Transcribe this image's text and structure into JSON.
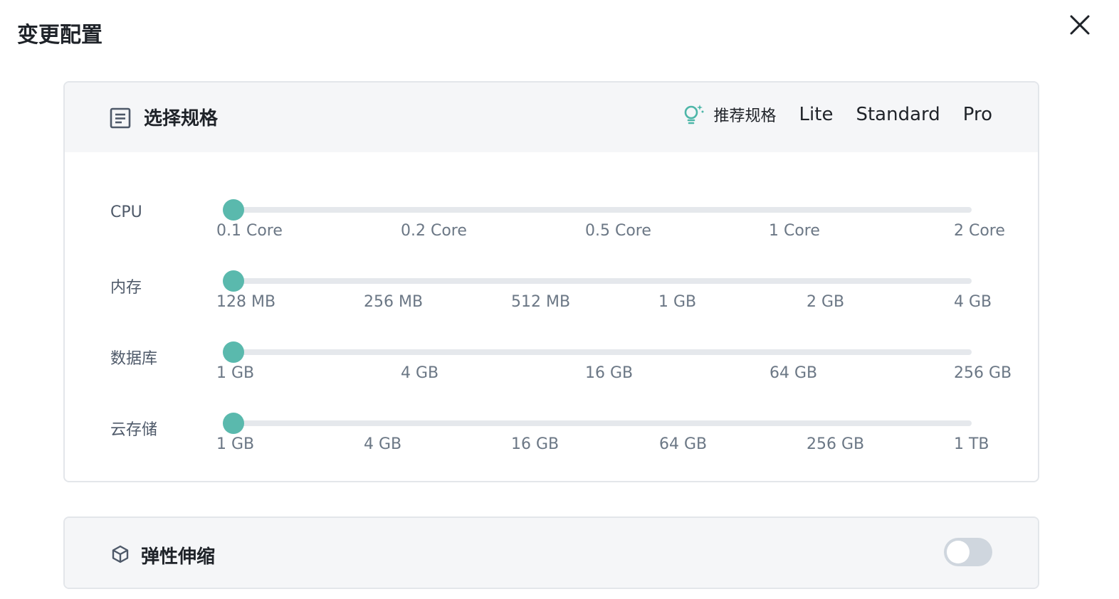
{
  "modal": {
    "title": "变更配置"
  },
  "spec": {
    "title": "选择规格",
    "recommend_label": "推荐规格",
    "presets": [
      "Lite",
      "Standard",
      "Pro"
    ],
    "sliders": [
      {
        "label": "CPU",
        "marks": [
          "0.1 Core",
          "0.2 Core",
          "0.5 Core",
          "1 Core",
          "2 Core"
        ],
        "selected": "0.1 Core"
      },
      {
        "label": "内存",
        "marks": [
          "128 MB",
          "256 MB",
          "512 MB",
          "1 GB",
          "2 GB",
          "4 GB"
        ],
        "selected": "128 MB"
      },
      {
        "label": "数据库",
        "marks": [
          "1 GB",
          "4 GB",
          "16 GB",
          "64 GB",
          "256 GB"
        ],
        "selected": "1 GB"
      },
      {
        "label": "云存储",
        "marks": [
          "1 GB",
          "4 GB",
          "16 GB",
          "64 GB",
          "256 GB",
          "1 TB"
        ],
        "selected": "1 GB"
      }
    ]
  },
  "autoscale": {
    "title": "弹性伸缩",
    "enabled": false
  },
  "colors": {
    "accent": "#5ab9ad",
    "track": "#e5e8ec",
    "header_bg": "#f5f6f8",
    "toggle_off": "#cfd6de"
  }
}
